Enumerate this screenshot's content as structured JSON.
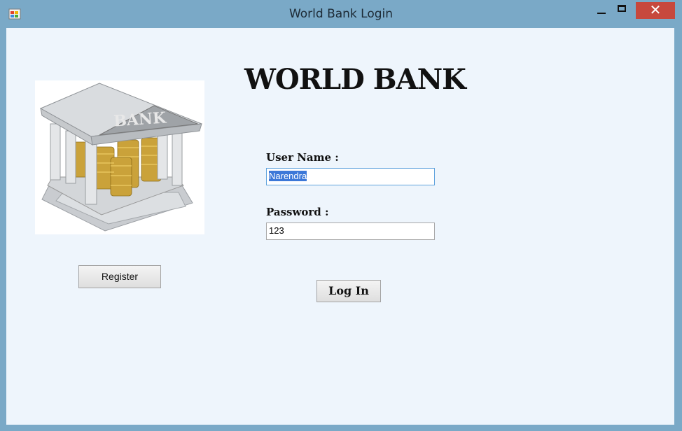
{
  "window": {
    "title": "World Bank Login",
    "close_glyph": "✕",
    "icons": [
      "app-icon",
      "minimize-icon",
      "maximize-icon",
      "close-icon"
    ]
  },
  "logo": {
    "heading": "WORLD BANK",
    "image_text": "BANK"
  },
  "form": {
    "username_label": "User Name :",
    "username_value": "Narendra",
    "password_label": "Password :",
    "password_value": "123",
    "login_label": "Log In",
    "register_label": "Register"
  },
  "colors": {
    "titlebar": "#7aa9c7",
    "client_bg": "#eef5fc",
    "close_button": "#c7483d",
    "selection": "#3c78d8"
  }
}
